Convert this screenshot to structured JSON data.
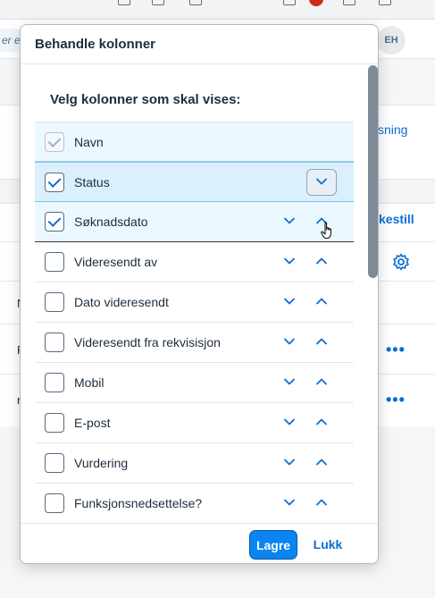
{
  "background": {
    "search_placeholder": "er e",
    "avatar_initials": "EH",
    "link_right_top": "sning",
    "link_right_mid": "kestill",
    "row_edge_letters": [
      "N",
      "F",
      "n"
    ]
  },
  "dialog": {
    "title": "Behandle kolonner",
    "section_heading": "Velg kolonner som skal vises:",
    "columns": [
      {
        "label": "Navn",
        "checked": true,
        "disabled": true
      },
      {
        "label": "Status",
        "checked": true
      },
      {
        "label": "Søknadsdato",
        "checked": true
      },
      {
        "label": "Videresendt av",
        "checked": false
      },
      {
        "label": "Dato videresendt",
        "checked": false
      },
      {
        "label": "Videresendt fra rekvisisjon",
        "checked": false
      },
      {
        "label": "Mobil",
        "checked": false
      },
      {
        "label": "E-post",
        "checked": false
      },
      {
        "label": "Vurdering",
        "checked": false
      },
      {
        "label": "Funksjonsnedsettelse?",
        "checked": false
      }
    ],
    "save_label": "Lagre",
    "close_label": "Lukk"
  },
  "colors": {
    "accent": "#0a6ed1",
    "primary_button": "#0a84f0",
    "selected_row": "#ebf8ff",
    "hover_row": "#dbf0fc"
  },
  "icons": {
    "move_down": "chevron-down-icon",
    "move_up": "chevron-up-icon",
    "settings": "gear-icon",
    "more": "more-horizontal-icon"
  }
}
